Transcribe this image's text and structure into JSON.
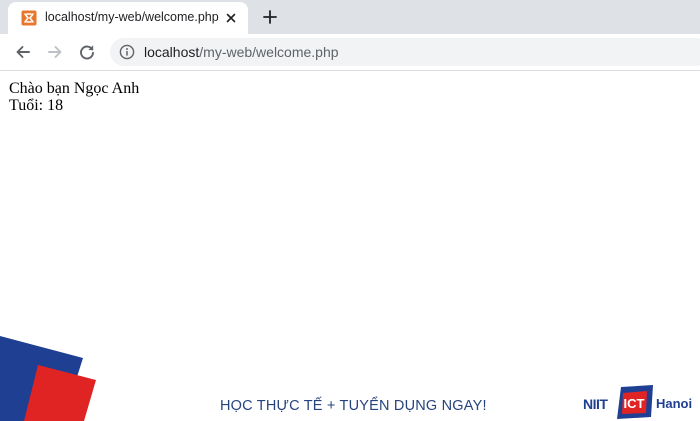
{
  "browser": {
    "tab": {
      "title": "localhost/my-web/welcome.php",
      "favicon": "xampp-icon"
    },
    "toolbar": {
      "back_icon": "back-arrow-icon",
      "forward_icon": "forward-arrow-icon",
      "reload_icon": "reload-icon",
      "url_host": "localhost",
      "url_path": "/my-web/welcome.php"
    },
    "colors": {
      "tabstrip": "#dee1e6",
      "omnibox": "#f1f3f4",
      "favicon": "#e8772e"
    }
  },
  "page": {
    "greeting": "Chào bạn Ngọc Anh",
    "age": "Tuổi: 18"
  },
  "banner": {
    "slogan": "HỌC THỰC TẾ + TUYỂN DỤNG NGAY!",
    "logo_left": "NIIT",
    "logo_mark": "ICT",
    "logo_right": "Hanoi",
    "colors": {
      "blue": "#1f3f93",
      "red": "#e02424",
      "slogan": "#27437e"
    }
  }
}
